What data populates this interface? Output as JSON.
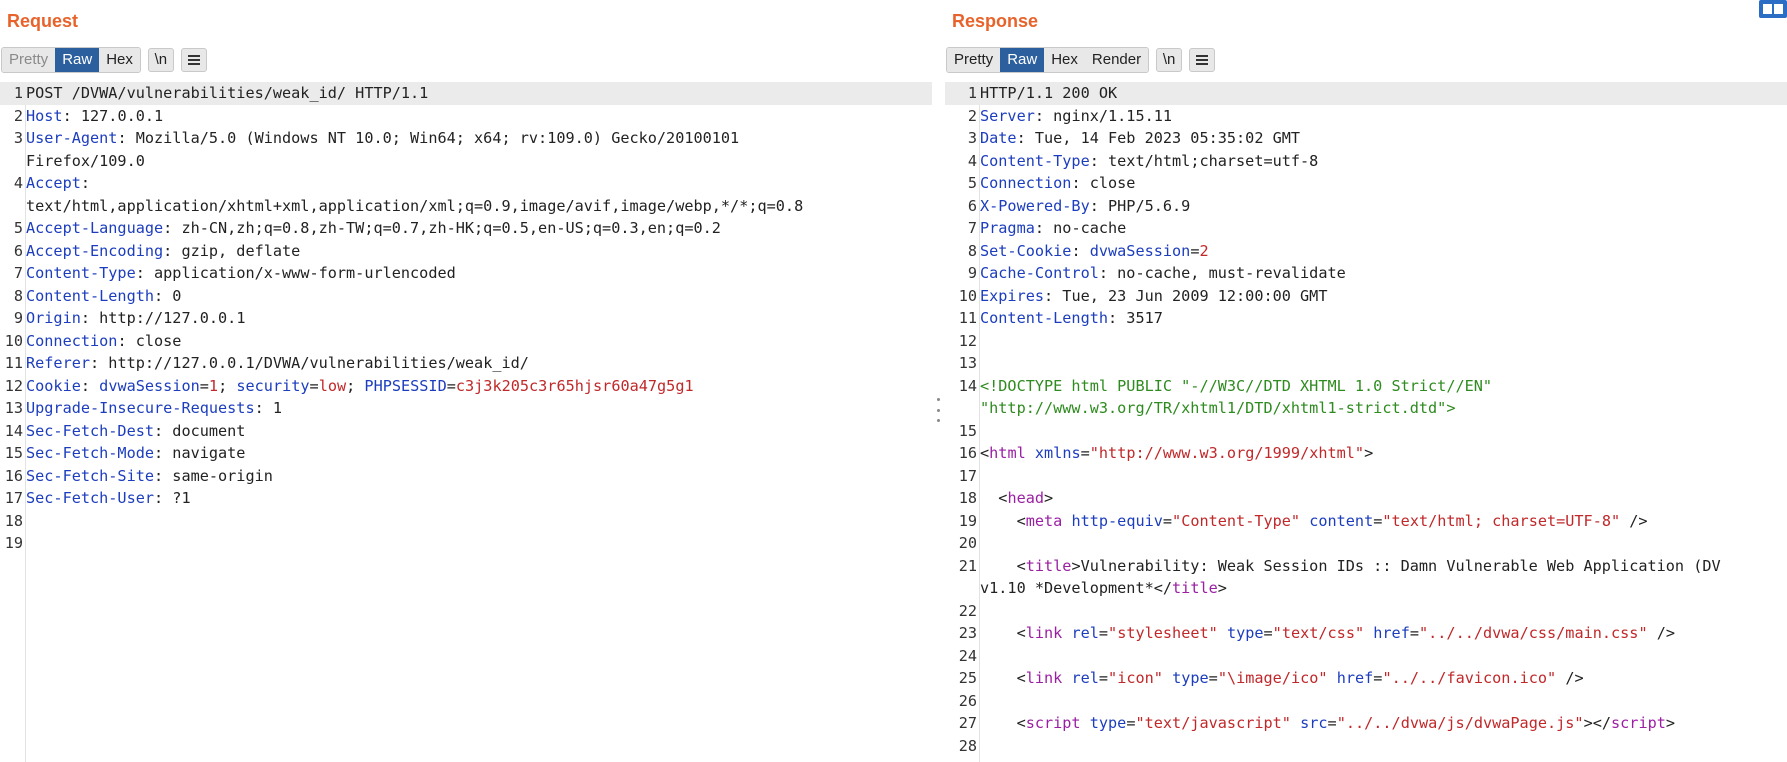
{
  "request": {
    "title": "Request",
    "tabs": [
      "Pretty",
      "Raw",
      "Hex"
    ],
    "active_tab": "Raw",
    "newline_label": "\\n",
    "menu_icon": "hamburger-menu-icon",
    "lines": [
      {
        "n": "1",
        "parts": [
          {
            "c": "v",
            "t": "POST /DVWA/vulnerabilities/weak_id/ HTTP/1.1"
          }
        ],
        "hl": true
      },
      {
        "n": "2",
        "parts": [
          {
            "c": "k",
            "t": "Host"
          },
          {
            "c": "v",
            "t": ": 127.0.0.1"
          }
        ]
      },
      {
        "n": "3",
        "parts": [
          {
            "c": "k",
            "t": "User-Agent"
          },
          {
            "c": "v",
            "t": ": Mozilla/5.0 (Windows NT 10.0; Win64; x64; rv:109.0) Gecko/20100101"
          }
        ]
      },
      {
        "n": "",
        "parts": [
          {
            "c": "v",
            "t": "Firefox/109.0"
          }
        ]
      },
      {
        "n": "4",
        "parts": [
          {
            "c": "k",
            "t": "Accept"
          },
          {
            "c": "v",
            "t": ":"
          }
        ]
      },
      {
        "n": "",
        "parts": [
          {
            "c": "v",
            "t": "text/html,application/xhtml+xml,application/xml;q=0.9,image/avif,image/webp,*/*;q=0.8"
          }
        ]
      },
      {
        "n": "5",
        "parts": [
          {
            "c": "k",
            "t": "Accept-Language"
          },
          {
            "c": "v",
            "t": ": zh-CN,zh;q=0.8,zh-TW;q=0.7,zh-HK;q=0.5,en-US;q=0.3,en;q=0.2"
          }
        ]
      },
      {
        "n": "6",
        "parts": [
          {
            "c": "k",
            "t": "Accept-Encoding"
          },
          {
            "c": "v",
            "t": ": gzip, deflate"
          }
        ]
      },
      {
        "n": "7",
        "parts": [
          {
            "c": "k",
            "t": "Content-Type"
          },
          {
            "c": "v",
            "t": ": application/x-www-form-urlencoded"
          }
        ]
      },
      {
        "n": "8",
        "parts": [
          {
            "c": "k",
            "t": "Content-Length"
          },
          {
            "c": "v",
            "t": ": 0"
          }
        ]
      },
      {
        "n": "9",
        "parts": [
          {
            "c": "k",
            "t": "Origin"
          },
          {
            "c": "v",
            "t": ": http://127.0.0.1"
          }
        ]
      },
      {
        "n": "10",
        "parts": [
          {
            "c": "k",
            "t": "Connection"
          },
          {
            "c": "v",
            "t": ": close"
          }
        ]
      },
      {
        "n": "11",
        "parts": [
          {
            "c": "k",
            "t": "Referer"
          },
          {
            "c": "v",
            "t": ": http://127.0.0.1/DVWA/vulnerabilities/weak_id/"
          }
        ]
      },
      {
        "n": "12",
        "parts": [
          {
            "c": "k",
            "t": "Cookie"
          },
          {
            "c": "v",
            "t": ": "
          },
          {
            "c": "k",
            "t": "dvwaSession"
          },
          {
            "c": "v",
            "t": "="
          },
          {
            "c": "r",
            "t": "1"
          },
          {
            "c": "v",
            "t": "; "
          },
          {
            "c": "k",
            "t": "security"
          },
          {
            "c": "v",
            "t": "="
          },
          {
            "c": "r",
            "t": "low"
          },
          {
            "c": "v",
            "t": "; "
          },
          {
            "c": "k",
            "t": "PHPSESSID"
          },
          {
            "c": "v",
            "t": "="
          },
          {
            "c": "r",
            "t": "c3j3k205c3r65hjsr60a47g5g1"
          }
        ]
      },
      {
        "n": "13",
        "parts": [
          {
            "c": "k",
            "t": "Upgrade-Insecure-Requests"
          },
          {
            "c": "v",
            "t": ": 1"
          }
        ]
      },
      {
        "n": "14",
        "parts": [
          {
            "c": "k",
            "t": "Sec-Fetch-Dest"
          },
          {
            "c": "v",
            "t": ": document"
          }
        ]
      },
      {
        "n": "15",
        "parts": [
          {
            "c": "k",
            "t": "Sec-Fetch-Mode"
          },
          {
            "c": "v",
            "t": ": navigate"
          }
        ]
      },
      {
        "n": "16",
        "parts": [
          {
            "c": "k",
            "t": "Sec-Fetch-Site"
          },
          {
            "c": "v",
            "t": ": same-origin"
          }
        ]
      },
      {
        "n": "17",
        "parts": [
          {
            "c": "k",
            "t": "Sec-Fetch-User"
          },
          {
            "c": "v",
            "t": ": ?1"
          }
        ]
      },
      {
        "n": "18",
        "parts": []
      },
      {
        "n": "19",
        "parts": []
      }
    ]
  },
  "response": {
    "title": "Response",
    "tabs": [
      "Pretty",
      "Raw",
      "Hex",
      "Render"
    ],
    "active_tab": "Raw",
    "newline_label": "\\n",
    "menu_icon": "hamburger-menu-icon",
    "lines": [
      {
        "n": "1",
        "parts": [
          {
            "c": "v",
            "t": "HTTP/1.1 200 OK"
          }
        ],
        "hl": true
      },
      {
        "n": "2",
        "parts": [
          {
            "c": "k",
            "t": "Server"
          },
          {
            "c": "v",
            "t": ": nginx/1.15.11"
          }
        ]
      },
      {
        "n": "3",
        "parts": [
          {
            "c": "k",
            "t": "Date"
          },
          {
            "c": "v",
            "t": ": Tue, 14 Feb 2023 05:35:02 GMT"
          }
        ]
      },
      {
        "n": "4",
        "parts": [
          {
            "c": "k",
            "t": "Content-Type"
          },
          {
            "c": "v",
            "t": ": text/html;charset=utf-8"
          }
        ]
      },
      {
        "n": "5",
        "parts": [
          {
            "c": "k",
            "t": "Connection"
          },
          {
            "c": "v",
            "t": ": close"
          }
        ]
      },
      {
        "n": "6",
        "parts": [
          {
            "c": "k",
            "t": "X-Powered-By"
          },
          {
            "c": "v",
            "t": ": PHP/5.6.9"
          }
        ]
      },
      {
        "n": "7",
        "parts": [
          {
            "c": "k",
            "t": "Pragma"
          },
          {
            "c": "v",
            "t": ": no-cache"
          }
        ]
      },
      {
        "n": "8",
        "parts": [
          {
            "c": "k",
            "t": "Set-Cookie"
          },
          {
            "c": "v",
            "t": ": "
          },
          {
            "c": "k",
            "t": "dvwaSession"
          },
          {
            "c": "v",
            "t": "="
          },
          {
            "c": "r",
            "t": "2"
          }
        ]
      },
      {
        "n": "9",
        "parts": [
          {
            "c": "k",
            "t": "Cache-Control"
          },
          {
            "c": "v",
            "t": ": no-cache, must-revalidate"
          }
        ]
      },
      {
        "n": "10",
        "parts": [
          {
            "c": "k",
            "t": "Expires"
          },
          {
            "c": "v",
            "t": ": Tue, 23 Jun 2009 12:00:00 GMT"
          }
        ]
      },
      {
        "n": "11",
        "parts": [
          {
            "c": "k",
            "t": "Content-Length"
          },
          {
            "c": "v",
            "t": ": 3517"
          }
        ]
      },
      {
        "n": "12",
        "parts": []
      },
      {
        "n": "13",
        "parts": []
      },
      {
        "n": "14",
        "parts": [
          {
            "c": "g",
            "t": "<!DOCTYPE html PUBLIC \"-//W3C//DTD XHTML 1.0 Strict//EN\""
          }
        ]
      },
      {
        "n": "",
        "parts": [
          {
            "c": "g",
            "t": "\"http://www.w3.org/TR/xhtml1/DTD/xhtml1-strict.dtd\">"
          }
        ]
      },
      {
        "n": "15",
        "parts": []
      },
      {
        "n": "16",
        "parts": [
          {
            "c": "v",
            "t": "<"
          },
          {
            "c": "t",
            "t": "html"
          },
          {
            "c": "v",
            "t": " "
          },
          {
            "c": "a",
            "t": "xmlns"
          },
          {
            "c": "v",
            "t": "="
          },
          {
            "c": "s",
            "t": "\"http://www.w3.org/1999/xhtml\""
          },
          {
            "c": "v",
            "t": ">"
          }
        ]
      },
      {
        "n": "17",
        "parts": []
      },
      {
        "n": "18",
        "parts": [
          {
            "c": "v",
            "t": "  <"
          },
          {
            "c": "t",
            "t": "head"
          },
          {
            "c": "v",
            "t": ">"
          }
        ]
      },
      {
        "n": "19",
        "parts": [
          {
            "c": "v",
            "t": "    <"
          },
          {
            "c": "t",
            "t": "meta"
          },
          {
            "c": "v",
            "t": " "
          },
          {
            "c": "a",
            "t": "http-equiv"
          },
          {
            "c": "v",
            "t": "="
          },
          {
            "c": "s",
            "t": "\"Content-Type\""
          },
          {
            "c": "v",
            "t": " "
          },
          {
            "c": "a",
            "t": "content"
          },
          {
            "c": "v",
            "t": "="
          },
          {
            "c": "s",
            "t": "\"text/html; charset=UTF-8\""
          },
          {
            "c": "v",
            "t": " />"
          }
        ]
      },
      {
        "n": "20",
        "parts": []
      },
      {
        "n": "21",
        "parts": [
          {
            "c": "v",
            "t": "    <"
          },
          {
            "c": "t",
            "t": "title"
          },
          {
            "c": "v",
            "t": ">Vulnerability: Weak Session IDs :: Damn Vulnerable Web Application (DV"
          }
        ]
      },
      {
        "n": "",
        "parts": [
          {
            "c": "v",
            "t": "v1.10 *Development*</"
          },
          {
            "c": "t",
            "t": "title"
          },
          {
            "c": "v",
            "t": ">"
          }
        ]
      },
      {
        "n": "22",
        "parts": []
      },
      {
        "n": "23",
        "parts": [
          {
            "c": "v",
            "t": "    <"
          },
          {
            "c": "t",
            "t": "link"
          },
          {
            "c": "v",
            "t": " "
          },
          {
            "c": "a",
            "t": "rel"
          },
          {
            "c": "v",
            "t": "="
          },
          {
            "c": "s",
            "t": "\"stylesheet\""
          },
          {
            "c": "v",
            "t": " "
          },
          {
            "c": "a",
            "t": "type"
          },
          {
            "c": "v",
            "t": "="
          },
          {
            "c": "s",
            "t": "\"text/css\""
          },
          {
            "c": "v",
            "t": " "
          },
          {
            "c": "a",
            "t": "href"
          },
          {
            "c": "v",
            "t": "="
          },
          {
            "c": "s",
            "t": "\"../../dvwa/css/main.css\""
          },
          {
            "c": "v",
            "t": " />"
          }
        ]
      },
      {
        "n": "24",
        "parts": []
      },
      {
        "n": "25",
        "parts": [
          {
            "c": "v",
            "t": "    <"
          },
          {
            "c": "t",
            "t": "link"
          },
          {
            "c": "v",
            "t": " "
          },
          {
            "c": "a",
            "t": "rel"
          },
          {
            "c": "v",
            "t": "="
          },
          {
            "c": "s",
            "t": "\"icon\""
          },
          {
            "c": "v",
            "t": " "
          },
          {
            "c": "a",
            "t": "type"
          },
          {
            "c": "v",
            "t": "="
          },
          {
            "c": "s",
            "t": "\"\\image/ico\""
          },
          {
            "c": "v",
            "t": " "
          },
          {
            "c": "a",
            "t": "href"
          },
          {
            "c": "v",
            "t": "="
          },
          {
            "c": "s",
            "t": "\"../../favicon.ico\""
          },
          {
            "c": "v",
            "t": " />"
          }
        ]
      },
      {
        "n": "26",
        "parts": []
      },
      {
        "n": "27",
        "parts": [
          {
            "c": "v",
            "t": "    <"
          },
          {
            "c": "t",
            "t": "script"
          },
          {
            "c": "v",
            "t": " "
          },
          {
            "c": "a",
            "t": "type"
          },
          {
            "c": "v",
            "t": "="
          },
          {
            "c": "s",
            "t": "\"text/javascript\""
          },
          {
            "c": "v",
            "t": " "
          },
          {
            "c": "a",
            "t": "src"
          },
          {
            "c": "v",
            "t": "="
          },
          {
            "c": "s",
            "t": "\"../../dvwa/js/dvwaPage.js\""
          },
          {
            "c": "v",
            "t": "></"
          },
          {
            "c": "t",
            "t": "script"
          },
          {
            "c": "v",
            "t": ">"
          }
        ]
      },
      {
        "n": "28",
        "parts": []
      }
    ]
  },
  "colors": {
    "title_orange": "#e8632b",
    "active_tab_blue": "#2b5f9e",
    "header_key_blue": "#1c3dbd",
    "value_red": "#c0282a",
    "tag_purple": "#9b1fa3",
    "doctype_green": "#2e8b1f"
  },
  "layout_toggle_icon": "split-layout-icon"
}
